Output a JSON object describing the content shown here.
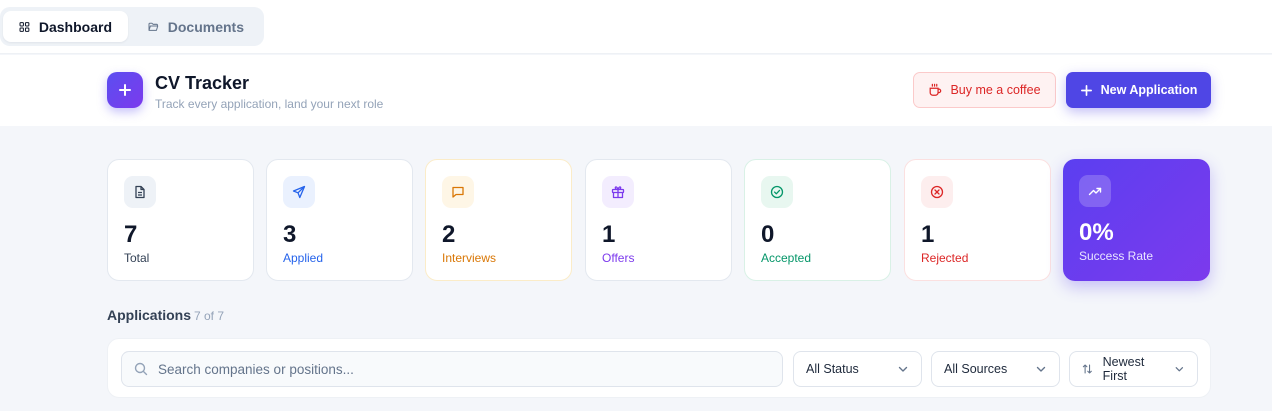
{
  "nav": {
    "tabs": [
      {
        "label": "Dashboard",
        "icon": "grid-icon",
        "active": true
      },
      {
        "label": "Documents",
        "icon": "folder-open-icon",
        "active": false
      }
    ]
  },
  "header": {
    "title": "CV Tracker",
    "subtitle": "Track every application, land your next role",
    "coffee_label": "Buy me a coffee",
    "new_label": "New Application"
  },
  "stats": [
    {
      "value": "7",
      "label": "Total",
      "icon": "file-text-icon",
      "color": "#334155",
      "bg": "#eef2f7"
    },
    {
      "value": "3",
      "label": "Applied",
      "icon": "send-icon",
      "color": "#2563eb",
      "bg": "#eaf1fe"
    },
    {
      "value": "2",
      "label": "Interviews",
      "icon": "message-square-icon",
      "color": "#d97706",
      "bg": "#fef6e6"
    },
    {
      "value": "1",
      "label": "Offers",
      "icon": "gift-icon",
      "color": "#7c3aed",
      "bg": "#f3edfe"
    },
    {
      "value": "0",
      "label": "Accepted",
      "icon": "check-circle-icon",
      "color": "#059669",
      "bg": "#e8f7f0"
    },
    {
      "value": "1",
      "label": "Rejected",
      "icon": "x-circle-icon",
      "color": "#dc2626",
      "bg": "#fdeeee"
    },
    {
      "value": "0%",
      "label": "Success Rate",
      "icon": "trending-up-icon",
      "color": "#ffffff",
      "bg": "rgba(255,255,255,0.2)"
    }
  ],
  "applications": {
    "title": "Applications",
    "count": "7 of 7"
  },
  "filters": {
    "search_placeholder": "Search companies or positions...",
    "status": "All Status",
    "sources": "All Sources",
    "sort": "Newest First"
  },
  "colors": {
    "accent": "#4f46e5",
    "danger": "#dc2626"
  }
}
